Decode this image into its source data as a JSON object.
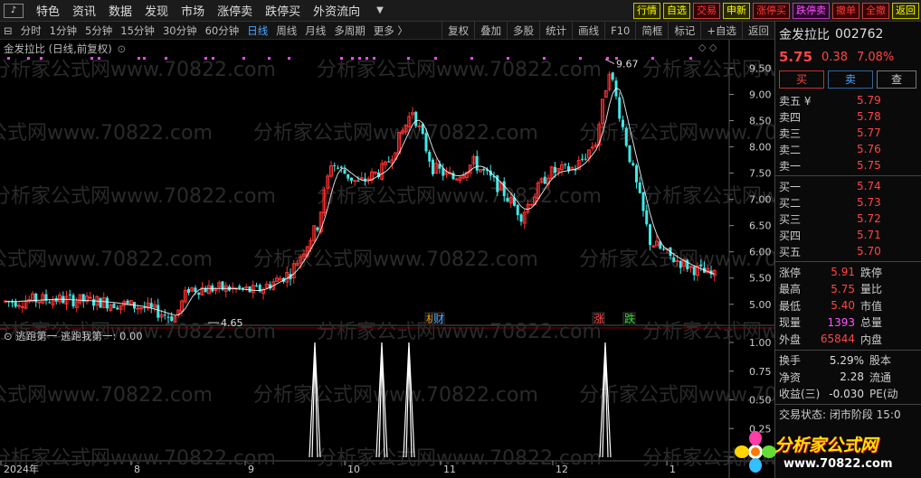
{
  "menu": {
    "logo": "♪",
    "items": [
      "特色",
      "资讯",
      "数据",
      "发现",
      "市场",
      "涨停卖",
      "跌停买",
      "外资流向"
    ],
    "caret": "▼",
    "quick_buttons": [
      {
        "label": "行情",
        "style": "yel"
      },
      {
        "label": "自选",
        "style": "yel"
      },
      {
        "label": "交易",
        "style": "red"
      },
      {
        "label": "申新",
        "style": "yel"
      },
      {
        "label": "涨停买",
        "style": "red"
      },
      {
        "label": "跌停卖",
        "style": "mag"
      },
      {
        "label": "撤单",
        "style": "red"
      },
      {
        "label": "全撤",
        "style": "red"
      },
      {
        "label": "返回",
        "style": "yel"
      }
    ]
  },
  "periods": {
    "toggle": "⊟",
    "items": [
      "分时",
      "1分钟",
      "5分钟",
      "15分钟",
      "30分钟",
      "60分钟",
      "日线",
      "周线",
      "月线",
      "多周期",
      "更多 〉"
    ],
    "active": "日线"
  },
  "tools": [
    "复权",
    "叠加",
    "多股",
    "统计",
    "画线",
    "F10",
    "简框",
    "标记",
    "+自选",
    "返回"
  ],
  "chart_title": "金发拉比 (日线,前复权)",
  "chart_title_icon": "⊙",
  "corner_icons": "◇ ◇",
  "indicator_title": "逃跑第一  逃跑我第一: 0.00",
  "indicator_toggle": "⊙",
  "watermark": "分析家公式网www.70822.com",
  "price_axis": [
    "9.50",
    "9.00",
    "8.50",
    "8.00",
    "7.50",
    "7.00",
    "6.50",
    "6.00",
    "5.50",
    "5.00"
  ],
  "ind_axis": [
    "1.00",
    "0.75",
    "0.50",
    "0.25",
    "0.00"
  ],
  "date_axis": [
    "2024年",
    "8",
    "9",
    "10",
    "11",
    "12",
    "1"
  ],
  "annotations": {
    "high": "9.67",
    "low": "4.65"
  },
  "markers": [
    {
      "text": "机",
      "color": "#ff9900"
    },
    {
      "text": "财",
      "color": "#4da6ff"
    },
    {
      "text": "涨",
      "color": "#ff4545"
    },
    {
      "text": "跌",
      "color": "#33dd33"
    }
  ],
  "panel": {
    "name": "金发拉比",
    "code": "002762",
    "price": "5.75",
    "change": "0.38",
    "change_pct": "7.08%",
    "buy_btn": "买",
    "sell_btn": "卖",
    "other_btn": "查",
    "asks": [
      {
        "label": "卖五 ¥",
        "price": "5.79"
      },
      {
        "label": "卖四",
        "price": "5.78"
      },
      {
        "label": "卖三",
        "price": "5.77"
      },
      {
        "label": "卖二",
        "price": "5.76"
      },
      {
        "label": "卖一",
        "price": "5.75"
      }
    ],
    "bids": [
      {
        "label": "买一",
        "price": "5.74"
      },
      {
        "label": "买二",
        "price": "5.73"
      },
      {
        "label": "买三",
        "price": "5.72"
      },
      {
        "label": "买四",
        "price": "5.71"
      },
      {
        "label": "买五",
        "price": "5.70"
      }
    ],
    "stats": [
      {
        "l1": "涨停",
        "v1": "5.91",
        "c1": "red",
        "l2": "跌停"
      },
      {
        "l1": "最高",
        "v1": "5.75",
        "c1": "red",
        "l2": "量比"
      },
      {
        "l1": "最低",
        "v1": "5.40",
        "c1": "red",
        "l2": "市值"
      },
      {
        "l1": "现量",
        "v1": "1393",
        "c1": "mag",
        "l2": "总量"
      },
      {
        "l1": "外盘",
        "v1": "65844",
        "c1": "red",
        "l2": "内盘"
      }
    ],
    "stats2": [
      {
        "l1": "换手",
        "v1": "5.29%",
        "l2": "股本"
      },
      {
        "l1": "净资",
        "v1": "2.28",
        "l2": "流通"
      },
      {
        "l1": "收益(三)",
        "v1": "-0.030",
        "l2": "PE(动"
      }
    ],
    "status": "交易状态: 闭市阶段 15:0"
  },
  "brand": {
    "text": "分析家公式网",
    "url": "www.70822.com"
  },
  "colors": {
    "up": "#ff3030",
    "down": "#40e8e8",
    "ma": "#ffffff",
    "signal": "#ff44ff"
  }
}
